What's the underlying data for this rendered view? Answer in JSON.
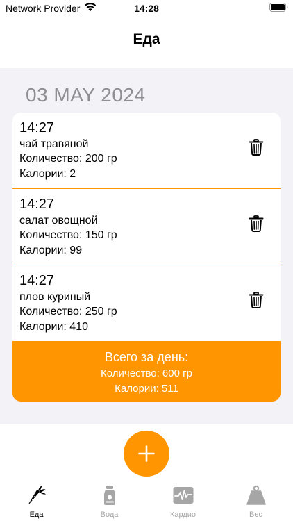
{
  "status_bar": {
    "carrier": "Network Provider",
    "time": "14:28"
  },
  "nav": {
    "title": "Еда"
  },
  "date_header": "03 MAY 2024",
  "entries": [
    {
      "time": "14:27",
      "name": "чай травяной",
      "quantity": "Количество: 200 гр",
      "calories": "Калории: 2"
    },
    {
      "time": "14:27",
      "name": "салат овощной",
      "quantity": "Количество: 150 гр",
      "calories": "Калории: 99"
    },
    {
      "time": "14:27",
      "name": "плов куриный",
      "quantity": "Количество: 250 гр",
      "calories": "Калории: 410"
    }
  ],
  "summary": {
    "title": "Всего за день:",
    "quantity": "Количество: 600 гр",
    "calories": "Калории: 511"
  },
  "tabs": [
    {
      "label": "Еда",
      "icon": "carrot-icon",
      "active": true
    },
    {
      "label": "Вода",
      "icon": "water-bottle-icon",
      "active": false
    },
    {
      "label": "Кардио",
      "icon": "heart-monitor-icon",
      "active": false
    },
    {
      "label": "Вес",
      "icon": "weight-icon",
      "active": false
    }
  ],
  "colors": {
    "accent": "#ff9500",
    "background": "#f2f2f7",
    "date_text": "#8e8e93",
    "inactive_tab": "#a6a6a6"
  }
}
